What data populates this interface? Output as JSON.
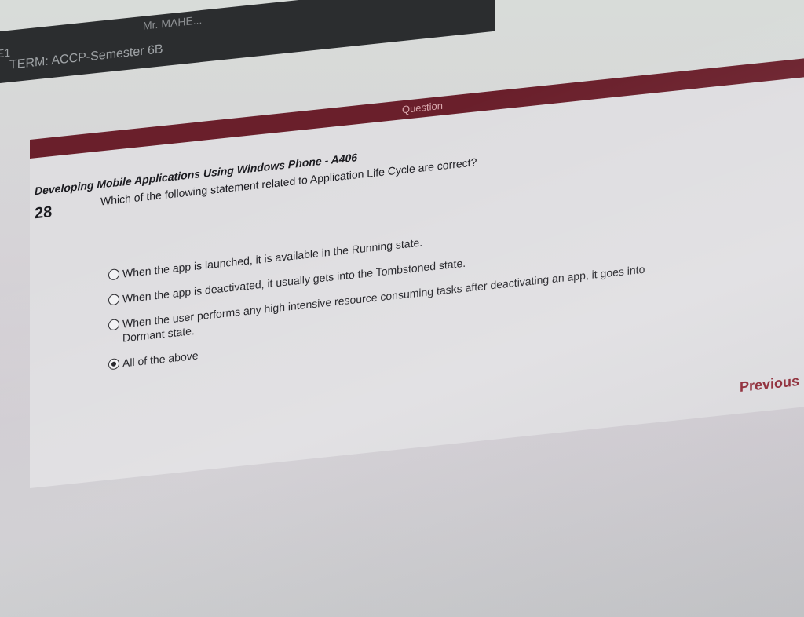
{
  "top_bar": {
    "edge_text": "E1",
    "user_name": "Mr. MAHE...",
    "term": "TERM: ACCP-Semester 6B"
  },
  "header": {
    "title": "Question"
  },
  "question": {
    "subject": "Developing Mobile Applications Using Windows Phone - A406",
    "number": "28",
    "text": "Which of the following statement related to Application Life Cycle are correct?",
    "options": [
      {
        "label": "When the app is launched, it is available in the Running state.",
        "selected": false
      },
      {
        "label": "When the app is deactivated, it usually gets into the Tombstoned state.",
        "selected": false
      },
      {
        "label": "When the user performs any high intensive resource consuming tasks after deactivating an app, it goes into Dormant state.",
        "selected": false
      },
      {
        "label": "All of the above",
        "selected": true
      }
    ]
  },
  "navigation": {
    "previous_label": "Previous"
  },
  "colors": {
    "accent": "#6a1f2b",
    "link": "#8a1e2c",
    "top_bar": "#2b2d2f"
  }
}
